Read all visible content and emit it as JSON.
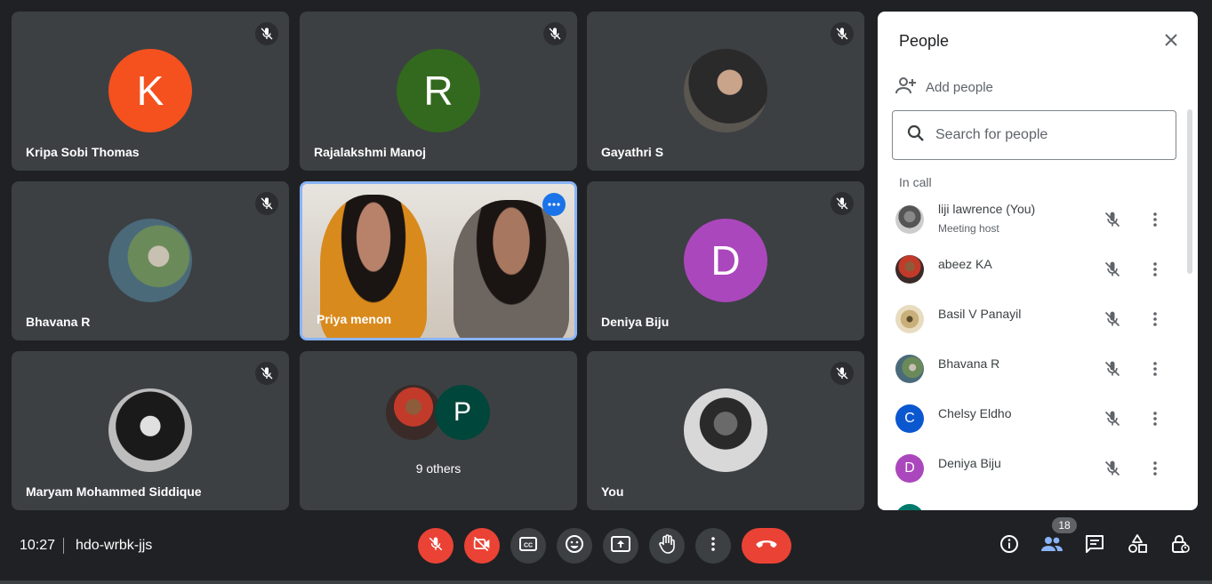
{
  "tiles": [
    {
      "name": "Kripa Sobi Thomas",
      "initial": "K",
      "color": "#f4511e"
    },
    {
      "name": "Rajalakshmi Manoj",
      "initial": "R",
      "color": "#33691e"
    },
    {
      "name": "Gayathri S"
    },
    {
      "name": "Bhavana R"
    },
    {
      "name": "Priya menon"
    },
    {
      "name": "Deniya Biju",
      "initial": "D",
      "color": "#ab47bc"
    },
    {
      "name": "Maryam Mohammed Siddique"
    },
    {
      "others_label": "9 others",
      "initial": "P",
      "color": "#00463a"
    },
    {
      "name": "You"
    }
  ],
  "panel": {
    "title": "People",
    "add_people": "Add people",
    "search_placeholder": "Search for people",
    "section": "In call",
    "participants": [
      {
        "name": "liji lawrence (You)",
        "role": "Meeting host"
      },
      {
        "name": "abeez KA"
      },
      {
        "name": "Basil V Panayil"
      },
      {
        "name": "Bhavana R"
      },
      {
        "name": "Chelsy Eldho",
        "initial": "C",
        "color": "#0b57d0"
      },
      {
        "name": "Deniya Biju",
        "initial": "D",
        "color": "#ab47bc"
      }
    ]
  },
  "bottom": {
    "time": "10:27",
    "meeting_code": "hdo-wrbk-jjs",
    "people_count": "18"
  },
  "colors": {
    "background": "#202124",
    "tile": "#3c4043",
    "accent": "#8ab4f8",
    "danger": "#ea4335"
  }
}
